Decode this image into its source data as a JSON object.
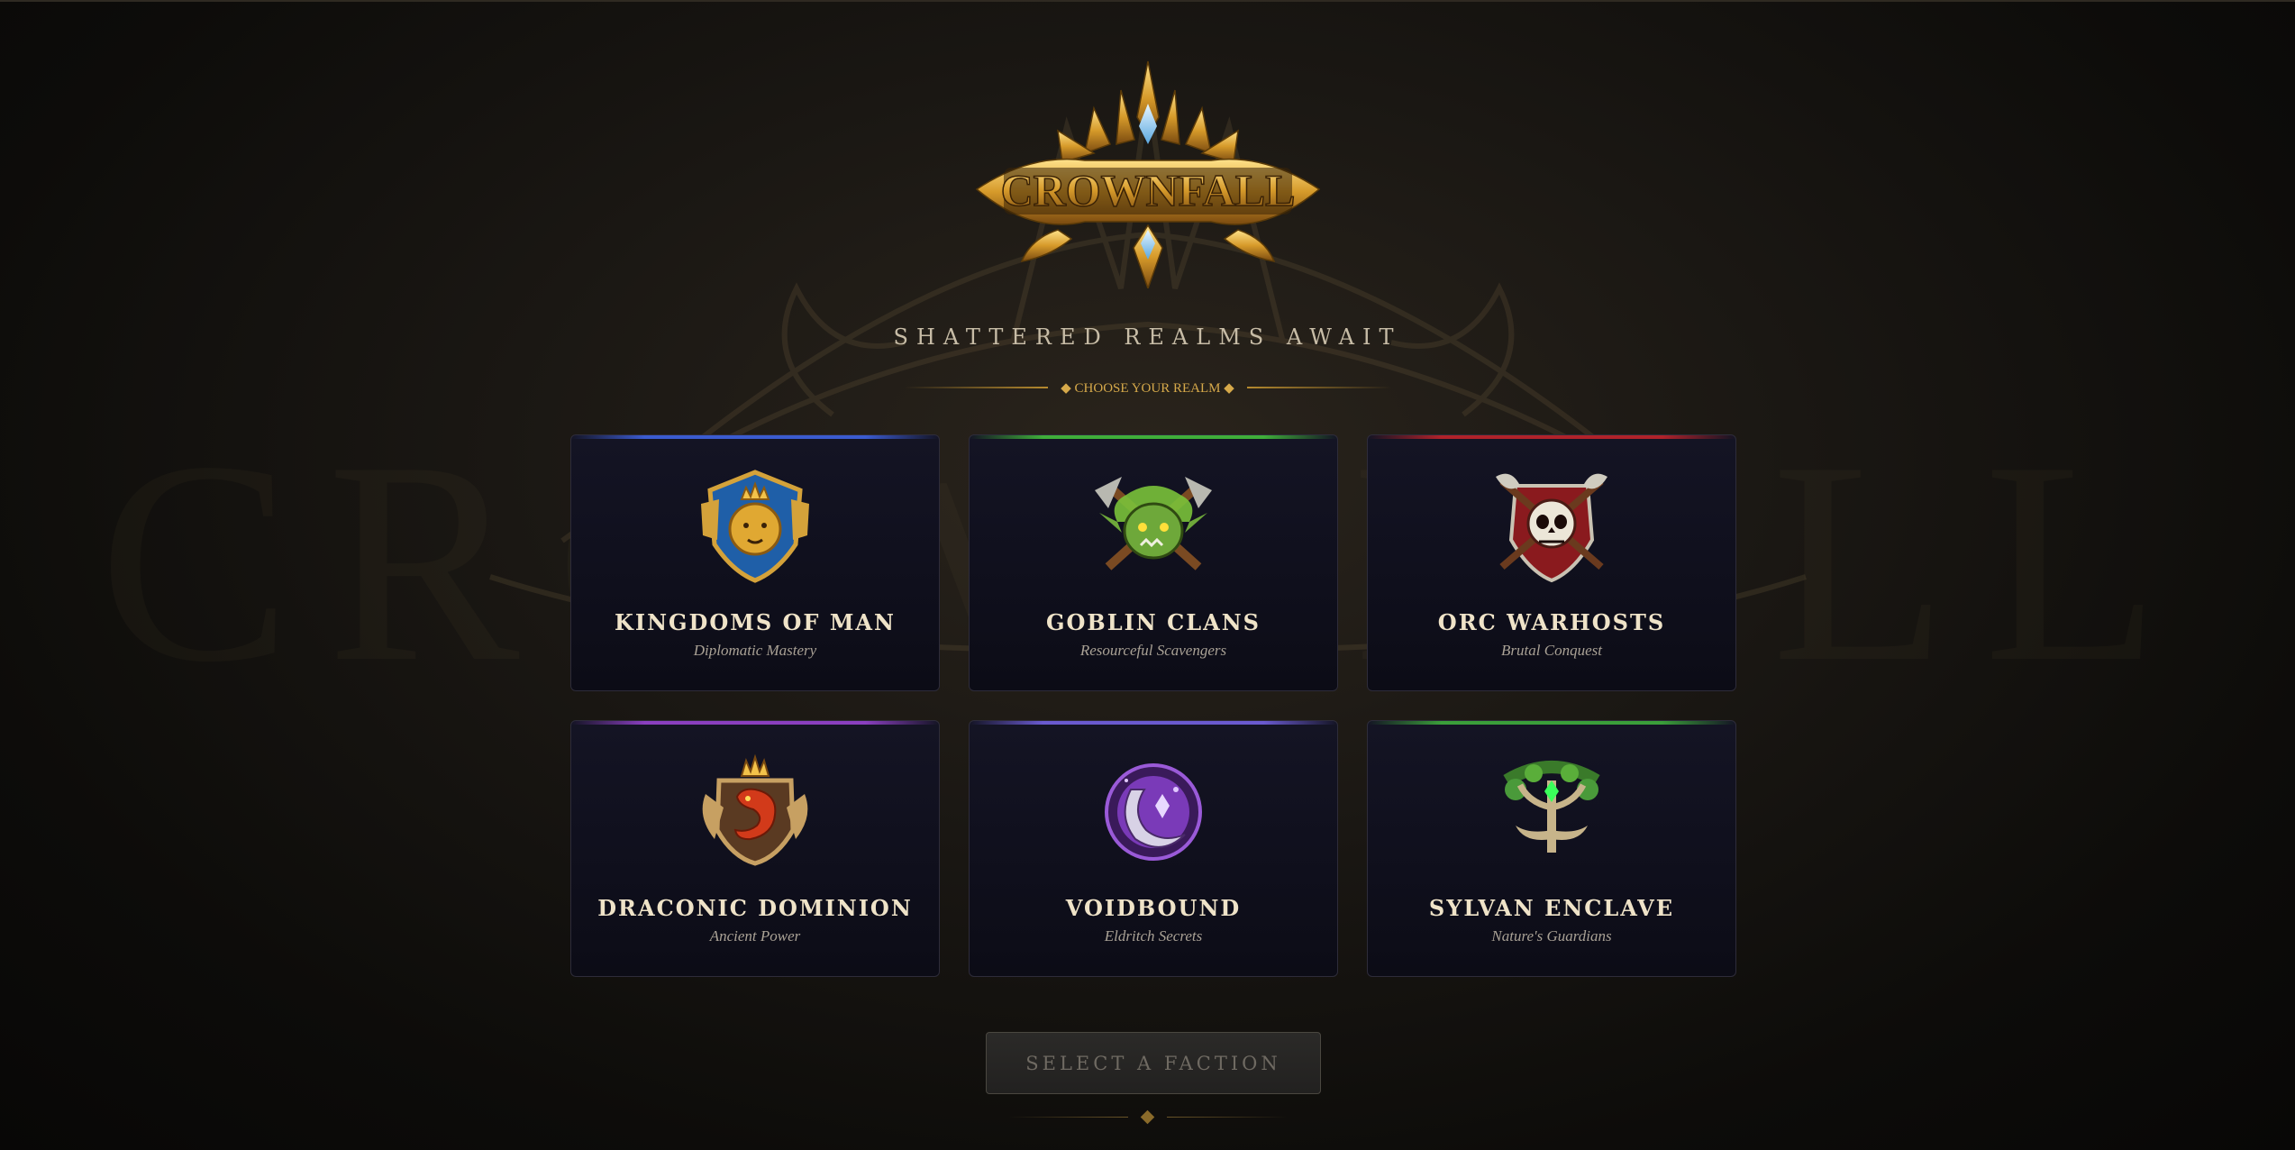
{
  "logo": {
    "text": "CROWNFALL"
  },
  "bg_word": "CROWNFALL",
  "subtitle": "SHATTERED REALMS AWAIT",
  "choose_label": "◆ CHOOSE YOUR REALM ◆",
  "factions": [
    {
      "name": "KINGDOMS OF MAN",
      "tagline": "Diplomatic Mastery",
      "accent": "#3b5bd0",
      "icon": "lion-crest-icon"
    },
    {
      "name": "GOBLIN CLANS",
      "tagline": "Resourceful Scavengers",
      "accent": "#3fae3a",
      "icon": "goblin-skull-icon"
    },
    {
      "name": "ORC WARHOSTS",
      "tagline": "Brutal Conquest",
      "accent": "#b0222a",
      "icon": "orc-skull-axes-icon"
    },
    {
      "name": "DRACONIC DOMINION",
      "tagline": "Ancient Power",
      "accent": "#8a3fc0",
      "icon": "dragon-crest-icon"
    },
    {
      "name": "VOIDBOUND",
      "tagline": "Eldritch Secrets",
      "accent": "#6a5ad0",
      "icon": "void-moon-icon"
    },
    {
      "name": "SYLVAN ENCLAVE",
      "tagline": "Nature's Guardians",
      "accent": "#3a9e3a",
      "icon": "tree-antler-icon"
    }
  ],
  "select_button": "SELECT A FACTION",
  "colors": {
    "gold": "#d6a94a",
    "card_bg": "#121220",
    "text": "#efe3c8"
  }
}
